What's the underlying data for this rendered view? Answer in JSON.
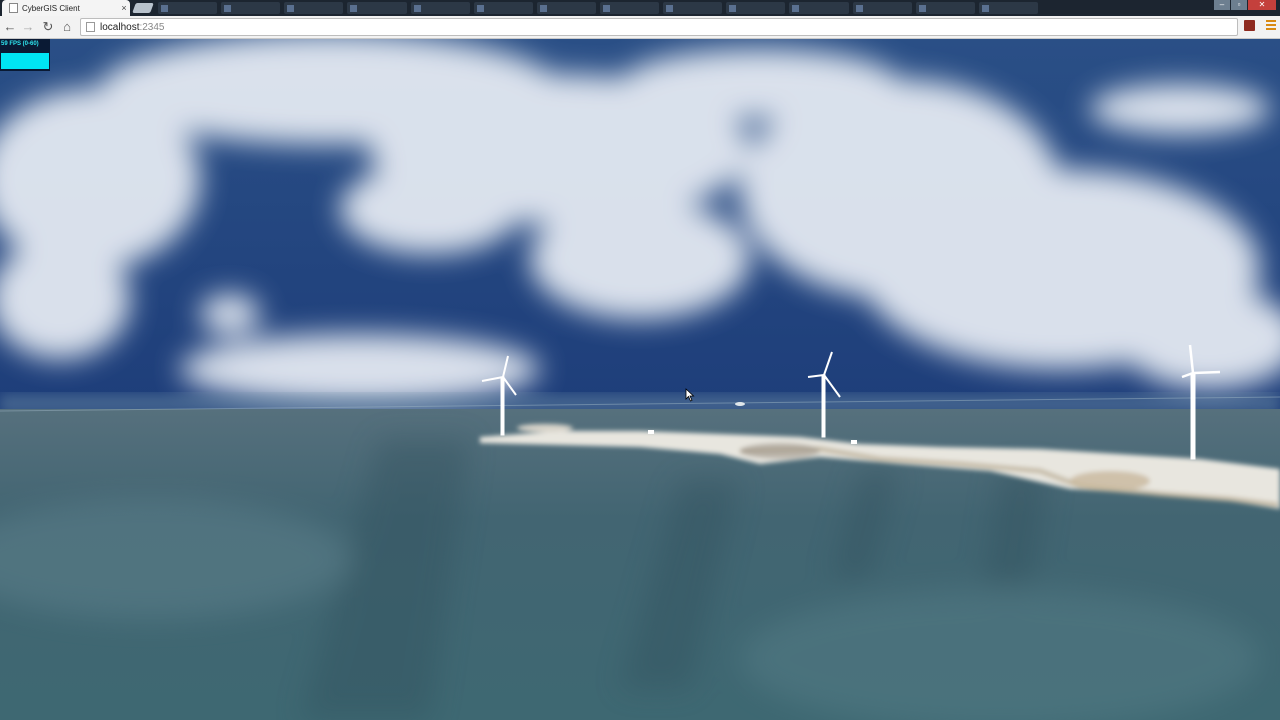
{
  "browser": {
    "tab": {
      "title": "CyberGIS Client",
      "close_label": "×"
    },
    "background_tab_count": 14,
    "nav": {
      "back": "←",
      "forward": "→",
      "reload": "↻",
      "home": "⌂"
    },
    "address": {
      "host": "localhost",
      "port": ":2345"
    },
    "window_controls": {
      "minimize": "–",
      "maximize": "▫",
      "close": "✕"
    },
    "icons": [
      "page-icon",
      "back-arrow-icon",
      "forward-arrow-icon",
      "reload-icon",
      "home-icon",
      "extension-icon",
      "menu-icon"
    ]
  },
  "stats": {
    "fps_text": "59 FPS (0-60)",
    "graph_color": "#00e5f4"
  },
  "scene": {
    "sky_color": "#27486f",
    "water_color": "#3b5e6a",
    "land_color": "#e8e6e0",
    "turbine_color": "#ffffff",
    "turbine_count": 3
  }
}
